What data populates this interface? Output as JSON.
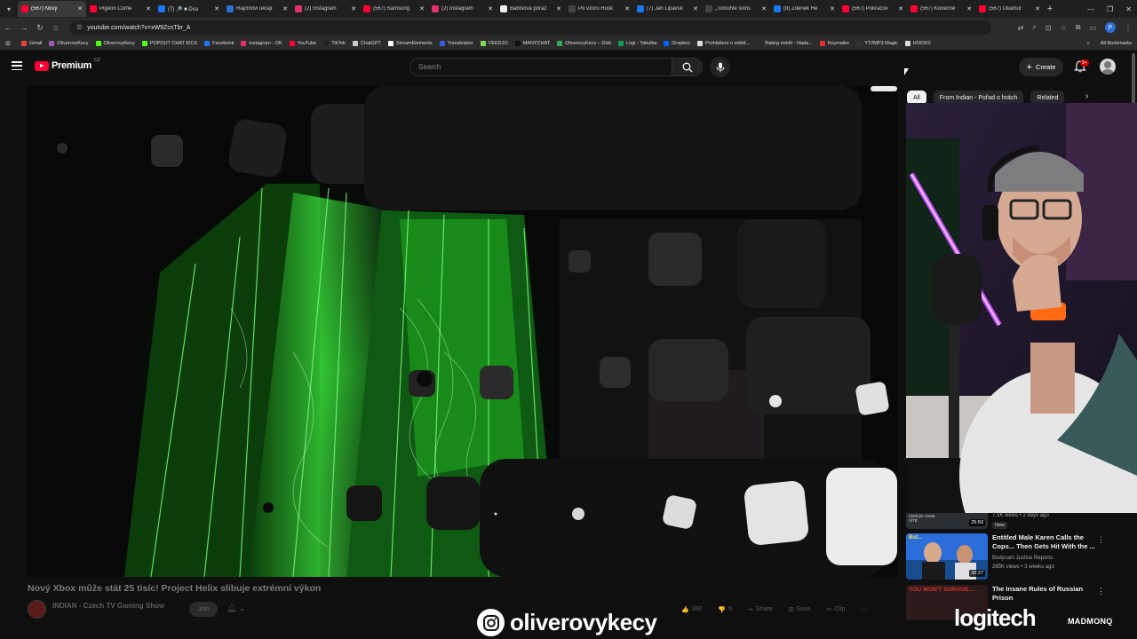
{
  "browser": {
    "tabs": [
      {
        "title": "(567) Nový",
        "active": true,
        "color": "#ff0033"
      },
      {
        "title": "Pigeon Come",
        "active": false,
        "color": "#ff0033"
      },
      {
        "title": "(7) 🔎 ■ Dva",
        "active": false,
        "color": "#1877f2"
      },
      {
        "title": "Rajchlovi ukrají",
        "active": false,
        "color": "#2a6fc9"
      },
      {
        "title": "(2) Instagram",
        "active": false,
        "color": "#e1306c"
      },
      {
        "title": "(567) Samsung",
        "active": false,
        "color": "#ff0033"
      },
      {
        "title": "(2) Instagram",
        "active": false,
        "color": "#e1306c"
      },
      {
        "title": "Babišova poraz",
        "active": false,
        "color": "#eeeeee"
      },
      {
        "title": "Po vzoru Rusk",
        "active": false,
        "color": "#444444"
      },
      {
        "title": "(7) Jan Lipavsk",
        "active": false,
        "color": "#1877f2"
      },
      {
        "title": "„Tomuhle svins",
        "active": false,
        "color": "#444444"
      },
      {
        "title": "(8) Zdenek He",
        "active": false,
        "color": "#1877f2"
      },
      {
        "title": "(567) Pokračov",
        "active": false,
        "color": "#ff0033"
      },
      {
        "title": "(567) Konečně",
        "active": false,
        "color": "#ff0033"
      },
      {
        "title": "(567) Okamur",
        "active": false,
        "color": "#ff0033"
      }
    ],
    "url": "youtube.com/watch?v=xW9ZcsTbr_A",
    "profile_initial": "P",
    "bookmarks": [
      {
        "label": "Gmail",
        "color": "#ea4335"
      },
      {
        "label": "OliverovyKecy",
        "color": "#9b59b6"
      },
      {
        "label": "OliverovyKecy",
        "color": "#53fc18"
      },
      {
        "label": "POPOUT CHAT KICK",
        "color": "#53fc18"
      },
      {
        "label": "Facebook",
        "color": "#1877f2"
      },
      {
        "label": "Instagram - OK",
        "color": "#e1306c"
      },
      {
        "label": "YouTube",
        "color": "#ff0033"
      },
      {
        "label": "TikTok",
        "color": "#222222"
      },
      {
        "label": "ChatGPT",
        "color": "#cccccc"
      },
      {
        "label": "StreamElements",
        "color": "#ffffff"
      },
      {
        "label": "Transkriptor",
        "color": "#3b5bdb"
      },
      {
        "label": "VEEDJO",
        "color": "#7fd858"
      },
      {
        "label": "MANYCHAT",
        "color": "#111111"
      },
      {
        "label": "OliverovyKecy – Disk",
        "color": "#34a853"
      },
      {
        "label": "Logi - Tabulka",
        "color": "#0f9d58"
      },
      {
        "label": "Dropbox",
        "color": "#0061ff"
      },
      {
        "label": "Prohlášení o volbě...",
        "color": "#dddddd"
      },
      {
        "label": "Rating médií - Nada...",
        "color": "#2b2b2b"
      },
      {
        "label": "Keymailer",
        "color": "#e03131"
      },
      {
        "label": "YT2MP3 Magic",
        "color": "#333333"
      },
      {
        "label": "HOOKS",
        "color": "#dddddd"
      }
    ],
    "all_bookmarks": "All Bookmarks"
  },
  "yt": {
    "logo": "Premium",
    "logo_region": "CZ",
    "search_placeholder": "Search",
    "create": "Create",
    "notif_badge": "9+"
  },
  "video": {
    "title": "Nový Xbox může stát 25 tisíc! Project Helix slibuje extrémní výkon",
    "channel": "INDIAN - Czech TV Gaming Show",
    "join": "Join",
    "actions": [
      {
        "icon": "like-icon",
        "glyph": "👍",
        "label": "390"
      },
      {
        "icon": "dislike-icon",
        "glyph": "👎",
        "label": "5"
      },
      {
        "icon": "share-icon",
        "glyph": "↪",
        "label": "Share"
      },
      {
        "icon": "save-icon",
        "glyph": "⊞",
        "label": "Save"
      },
      {
        "icon": "clip-icon",
        "glyph": "✂",
        "label": "Clip"
      },
      {
        "icon": "more-icon",
        "glyph": "⋯",
        "label": ""
      }
    ]
  },
  "rail": {
    "chips": [
      "All",
      "From Indian - Pořad o hrách",
      "Related"
    ],
    "partial": {
      "meta": "7.1K views • 2 days ago",
      "duration": "25:50",
      "badge": "New",
      "thumb_text": "ČERLÍD VANE VÍTĚ"
    },
    "items": [
      {
        "title": "Entitled Male Karen Calls the Cops... Then Gets Hit With the ...",
        "channel": "Bodycam Justice Reports",
        "meta": "285K views • 3 weeks ago",
        "duration": "30:27",
        "thumb_text": "But..."
      },
      {
        "title": "The Insane Rules of Russian Prison",
        "channel": "",
        "meta": "",
        "duration": "",
        "thumb_text": "YOU WON'T SURVIVE..."
      }
    ]
  },
  "overlay": {
    "handle": "oliverovykecy",
    "sponsor1": "logitech",
    "sponsor2": "MADMONQ"
  }
}
